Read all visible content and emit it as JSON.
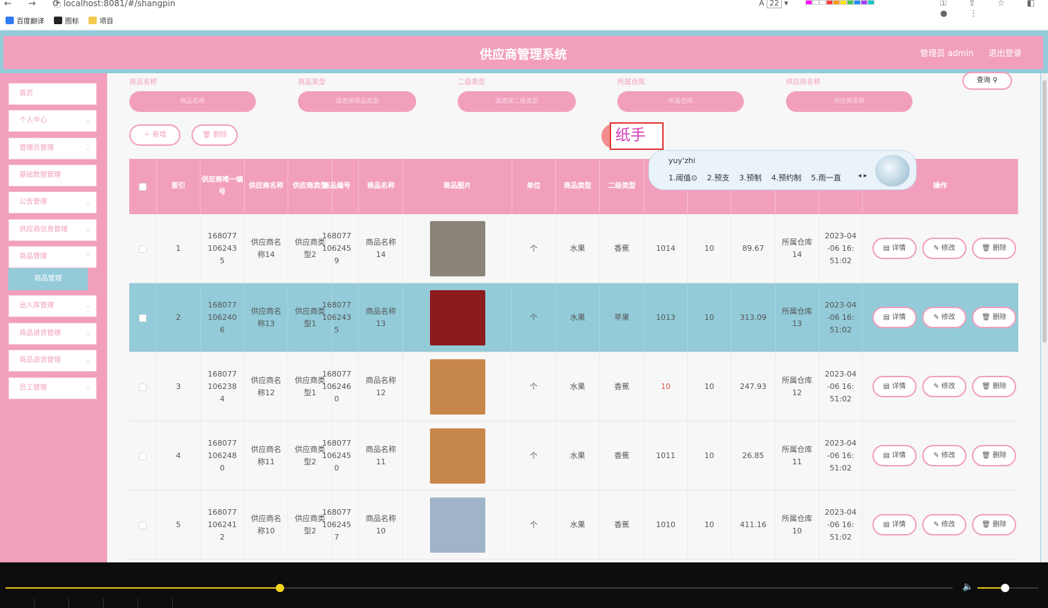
{
  "browser": {
    "url": "localhost:8081/#/shangpin",
    "nav_icons": "← → ⟳",
    "info_icon": "ⓘ",
    "font_size_value": "22",
    "bookmarks": [
      {
        "label": "百度翻译",
        "color": "#2f7cf6"
      },
      {
        "label": "图标",
        "color": "#222222"
      },
      {
        "label": "项目",
        "color": "#f2c94c"
      }
    ],
    "palette": [
      "#ff00ff",
      "#ffffff",
      "#ffffff",
      "#ff3b3b",
      "#ff9b00",
      "#ffe600",
      "#3cc84a",
      "#1a8cff",
      "#a040ff",
      "#00c8c8"
    ],
    "toolbar_icons": "⚿ ⇪ ☆ ◧ ● ⋮"
  },
  "header": {
    "title": "供应商管理系统",
    "admin": "管理员 admin",
    "logout": "退出登录"
  },
  "sidebar": {
    "items": [
      {
        "label": "首页",
        "chevron": ""
      },
      {
        "label": "个人中心",
        "chevron": "⌄"
      },
      {
        "label": "管理员管理",
        "chevron": "⌄"
      },
      {
        "label": "基础数据管理",
        "chevron": "⌄"
      },
      {
        "label": "公告管理",
        "chevron": "⌄"
      },
      {
        "label": "供应商信息管理",
        "chevron": "⌄"
      },
      {
        "label": "商品管理",
        "chevron": "⌃"
      },
      {
        "label": "出入库管理",
        "chevron": "⌄"
      },
      {
        "label": "商品进货管理",
        "chevron": "⌄"
      },
      {
        "label": "商品退货管理",
        "chevron": "⌄"
      },
      {
        "label": "员工管理",
        "chevron": "⌄"
      }
    ],
    "active_sub": "商品管理"
  },
  "filters": {
    "labels": [
      "商品名称",
      "商品类型",
      "二级类型",
      "所属仓库",
      "供应商名称"
    ],
    "placeholders": [
      "商品名称",
      "请选择商品类型",
      "请选择二级类型",
      "所属仓库",
      "供应商名称"
    ],
    "search_label": "查询",
    "search_icon": "⚲"
  },
  "actions": {
    "add": "＋ 新增",
    "delete": "🗑 删除"
  },
  "table": {
    "headers": [
      "",
      "索引",
      "供应商唯一编号",
      "供应商名称",
      "供应商类型",
      "商品编号",
      "商品名称",
      "商品图片",
      "单位",
      "商品类型",
      "二级类型",
      "",
      "",
      "",
      "",
      "",
      "操作"
    ],
    "detail_label": "▤ 详情",
    "edit_label": "✎ 修改",
    "del_label": "🗑 删除",
    "rows": [
      {
        "idx": "1",
        "sup_no": "1680771062435",
        "sup_name": "供应商名称14",
        "sup_type": "供应商类型2",
        "goods_no": "1680771062459",
        "goods_name": "商品名称14",
        "unit": "个",
        "type": "水果",
        "sub_type": "香蕉",
        "c1": "1014",
        "c2": "10",
        "price": "89.67",
        "warehouse": "所属仓库14",
        "time": "2023-04-06 16:51:02",
        "img_color": "#8a8578",
        "selected": false
      },
      {
        "idx": "2",
        "sup_no": "1680771062406",
        "sup_name": "供应商名称13",
        "sup_type": "供应商类型1",
        "goods_no": "1680771062435",
        "goods_name": "商品名称13",
        "unit": "个",
        "type": "水果",
        "sub_type": "苹果",
        "c1": "1013",
        "c2": "10",
        "price": "313.09",
        "warehouse": "所属仓库13",
        "time": "2023-04-06 16:51:02",
        "img_color": "#8c1a1f",
        "selected": true
      },
      {
        "idx": "3",
        "sup_no": "1680771062384",
        "sup_name": "供应商名称12",
        "sup_type": "供应商类型1",
        "goods_no": "1680771062460",
        "goods_name": "商品名称12",
        "unit": "个",
        "type": "水果",
        "sub_type": "香蕉",
        "c1": "10",
        "c2": "10",
        "price": "247.93",
        "warehouse": "所属仓库12",
        "time": "2023-04-06 16:51:02",
        "img_color": "#c7864a",
        "selected": false
      },
      {
        "idx": "4",
        "sup_no": "1680771062480",
        "sup_name": "供应商名称11",
        "sup_type": "供应商类型2",
        "goods_no": "1680771062450",
        "goods_name": "商品名称11",
        "unit": "个",
        "type": "水果",
        "sub_type": "香蕉",
        "c1": "1011",
        "c2": "10",
        "price": "26.85",
        "warehouse": "所属仓库11",
        "time": "2023-04-06 16:51:02",
        "img_color": "#c7864a",
        "selected": false
      },
      {
        "idx": "5",
        "sup_no": "1680771062412",
        "sup_name": "供应商名称10",
        "sup_type": "供应商类型2",
        "goods_no": "1680771062457",
        "goods_name": "商品名称10",
        "unit": "个",
        "type": "水果",
        "sub_type": "香蕉",
        "c1": "1010",
        "c2": "10",
        "price": "411.16",
        "warehouse": "所属仓库10",
        "time": "2023-04-06 16:51:02",
        "img_color": "#9fb4c8",
        "selected": false
      }
    ]
  },
  "ime": {
    "composing": "纸手",
    "pinyin": "yuy'zhi",
    "candidates": [
      "1.阈值⊙",
      "2.预支",
      "3.预制",
      "4.预约制",
      "5.雨一直"
    ],
    "arrows": "◂ ▸"
  },
  "player": {
    "progress": 0.29,
    "volume": 0.45
  },
  "colors": {
    "pink": "#f19fbd",
    "teal": "#93cbd9"
  }
}
